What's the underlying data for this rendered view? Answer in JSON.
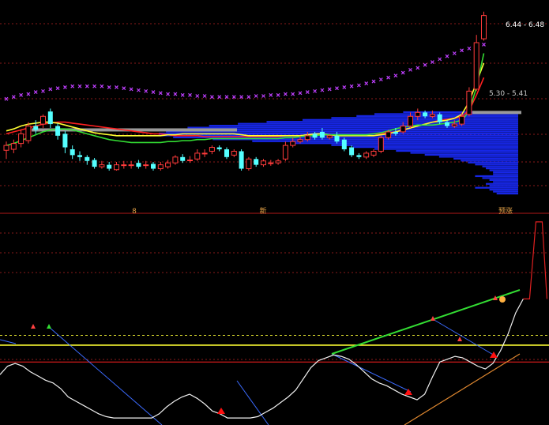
{
  "chart_data": [
    {
      "type": "candlestick",
      "title": "",
      "price_range_label": "6.44 - 6.48",
      "price_level_label": "5.30 - 5.41",
      "colors": {
        "up": "#ff3b3b",
        "down": "#54ffff",
        "ma_yellow": "#ffff33",
        "ma_red": "#ff2020",
        "ma_green": "#33dd33",
        "sar": "#c040ff",
        "volume_profile": "#1a2bff",
        "grid": "#8a1a1a"
      },
      "candles": [
        {
          "o": 5.05,
          "c": 5.1,
          "h": 5.14,
          "l": 4.96,
          "up": true
        },
        {
          "o": 5.06,
          "c": 5.12,
          "h": 5.16,
          "l": 5.02,
          "up": true
        },
        {
          "o": 5.12,
          "c": 5.22,
          "h": 5.26,
          "l": 5.08,
          "up": true
        },
        {
          "o": 5.15,
          "c": 5.3,
          "h": 5.34,
          "l": 5.12,
          "up": true
        },
        {
          "o": 5.3,
          "c": 5.26,
          "h": 5.36,
          "l": 5.22,
          "up": false
        },
        {
          "o": 5.32,
          "c": 5.4,
          "h": 5.42,
          "l": 5.28,
          "up": true
        },
        {
          "o": 5.45,
          "c": 5.32,
          "h": 5.48,
          "l": 5.28,
          "up": false
        },
        {
          "o": 5.3,
          "c": 5.2,
          "h": 5.33,
          "l": 5.16,
          "up": false
        },
        {
          "o": 5.22,
          "c": 5.08,
          "h": 5.25,
          "l": 5.02,
          "up": false
        },
        {
          "o": 5.06,
          "c": 5.0,
          "h": 5.1,
          "l": 4.96,
          "up": false
        },
        {
          "o": 5.0,
          "c": 4.98,
          "h": 5.04,
          "l": 4.94,
          "up": false
        },
        {
          "o": 4.98,
          "c": 4.94,
          "h": 5.0,
          "l": 4.9,
          "up": false
        },
        {
          "o": 4.95,
          "c": 4.88,
          "h": 4.97,
          "l": 4.86,
          "up": false
        },
        {
          "o": 4.88,
          "c": 4.9,
          "h": 4.94,
          "l": 4.86,
          "up": true
        },
        {
          "o": 4.9,
          "c": 4.86,
          "h": 4.93,
          "l": 4.84,
          "up": false
        },
        {
          "o": 4.85,
          "c": 4.9,
          "h": 4.93,
          "l": 4.84,
          "up": true
        },
        {
          "o": 4.9,
          "c": 4.9,
          "h": 4.94,
          "l": 4.86,
          "up": true
        },
        {
          "o": 4.9,
          "c": 4.9,
          "h": 4.94,
          "l": 4.86,
          "up": true
        },
        {
          "o": 4.92,
          "c": 4.88,
          "h": 4.95,
          "l": 4.86,
          "up": false
        },
        {
          "o": 4.9,
          "c": 4.9,
          "h": 4.94,
          "l": 4.86,
          "up": true
        },
        {
          "o": 4.91,
          "c": 4.86,
          "h": 4.93,
          "l": 4.84,
          "up": false
        },
        {
          "o": 4.86,
          "c": 4.9,
          "h": 4.93,
          "l": 4.84,
          "up": true
        },
        {
          "o": 4.88,
          "c": 4.92,
          "h": 4.95,
          "l": 4.86,
          "up": true
        },
        {
          "o": 4.92,
          "c": 4.98,
          "h": 5.0,
          "l": 4.9,
          "up": true
        },
        {
          "o": 4.98,
          "c": 4.94,
          "h": 5.01,
          "l": 4.92,
          "up": false
        },
        {
          "o": 4.95,
          "c": 4.95,
          "h": 4.99,
          "l": 4.92,
          "up": true
        },
        {
          "o": 4.96,
          "c": 5.02,
          "h": 5.06,
          "l": 4.94,
          "up": true
        },
        {
          "o": 5.02,
          "c": 5.02,
          "h": 5.06,
          "l": 4.98,
          "up": true
        },
        {
          "o": 5.04,
          "c": 5.08,
          "h": 5.1,
          "l": 5.01,
          "up": true
        },
        {
          "o": 5.08,
          "c": 5.06,
          "h": 5.1,
          "l": 5.04,
          "up": false
        },
        {
          "o": 5.06,
          "c": 4.98,
          "h": 5.08,
          "l": 4.96,
          "up": false
        },
        {
          "o": 5.0,
          "c": 5.04,
          "h": 5.06,
          "l": 4.98,
          "up": true
        },
        {
          "o": 5.04,
          "c": 4.86,
          "h": 5.06,
          "l": 4.84,
          "up": false
        },
        {
          "o": 4.86,
          "c": 4.96,
          "h": 4.98,
          "l": 4.84,
          "up": true
        },
        {
          "o": 4.96,
          "c": 4.9,
          "h": 4.98,
          "l": 4.88,
          "up": false
        },
        {
          "o": 4.9,
          "c": 4.94,
          "h": 4.96,
          "l": 4.88,
          "up": true
        },
        {
          "o": 4.92,
          "c": 4.92,
          "h": 4.95,
          "l": 4.89,
          "up": true
        },
        {
          "o": 4.92,
          "c": 4.94,
          "h": 4.96,
          "l": 4.9,
          "up": true
        },
        {
          "o": 4.96,
          "c": 5.1,
          "h": 5.14,
          "l": 4.94,
          "up": true
        },
        {
          "o": 5.1,
          "c": 5.14,
          "h": 5.18,
          "l": 5.08,
          "up": true
        },
        {
          "o": 5.14,
          "c": 5.16,
          "h": 5.2,
          "l": 5.12,
          "up": true
        },
        {
          "o": 5.16,
          "c": 5.2,
          "h": 5.24,
          "l": 5.14,
          "up": true
        },
        {
          "o": 5.22,
          "c": 5.18,
          "h": 5.24,
          "l": 5.16,
          "up": false
        },
        {
          "o": 5.24,
          "c": 5.18,
          "h": 5.28,
          "l": 5.16,
          "up": false
        },
        {
          "o": 5.18,
          "c": 5.2,
          "h": 5.22,
          "l": 5.16,
          "up": true
        },
        {
          "o": 5.2,
          "c": 5.14,
          "h": 5.24,
          "l": 5.12,
          "up": false
        },
        {
          "o": 5.16,
          "c": 5.06,
          "h": 5.18,
          "l": 5.04,
          "up": false
        },
        {
          "o": 5.08,
          "c": 5.0,
          "h": 5.1,
          "l": 4.98,
          "up": false
        },
        {
          "o": 5.0,
          "c": 4.98,
          "h": 5.02,
          "l": 4.96,
          "up": false
        },
        {
          "o": 4.98,
          "c": 5.02,
          "h": 5.04,
          "l": 4.96,
          "up": true
        },
        {
          "o": 5.0,
          "c": 5.04,
          "h": 5.06,
          "l": 4.98,
          "up": true
        },
        {
          "o": 5.04,
          "c": 5.18,
          "h": 5.2,
          "l": 5.02,
          "up": true
        },
        {
          "o": 5.18,
          "c": 5.24,
          "h": 5.26,
          "l": 5.16,
          "up": true
        },
        {
          "o": 5.24,
          "c": 5.22,
          "h": 5.28,
          "l": 5.2,
          "up": false
        },
        {
          "o": 5.24,
          "c": 5.3,
          "h": 5.34,
          "l": 5.22,
          "up": true
        },
        {
          "o": 5.3,
          "c": 5.4,
          "h": 5.44,
          "l": 5.28,
          "up": true
        },
        {
          "o": 5.4,
          "c": 5.44,
          "h": 5.48,
          "l": 5.36,
          "up": true
        },
        {
          "o": 5.44,
          "c": 5.4,
          "h": 5.46,
          "l": 5.38,
          "up": false
        },
        {
          "o": 5.4,
          "c": 5.42,
          "h": 5.46,
          "l": 5.38,
          "up": true
        },
        {
          "o": 5.42,
          "c": 5.34,
          "h": 5.44,
          "l": 5.32,
          "up": false
        },
        {
          "o": 5.34,
          "c": 5.3,
          "h": 5.36,
          "l": 5.28,
          "up": false
        },
        {
          "o": 5.3,
          "c": 5.32,
          "h": 5.36,
          "l": 5.28,
          "up": true
        },
        {
          "o": 5.32,
          "c": 5.4,
          "h": 5.44,
          "l": 5.3,
          "up": true
        },
        {
          "o": 5.42,
          "c": 5.66,
          "h": 5.7,
          "l": 5.4,
          "up": true
        },
        {
          "o": 5.68,
          "c": 6.16,
          "h": 6.24,
          "l": 5.66,
          "up": true
        },
        {
          "o": 6.2,
          "c": 6.44,
          "h": 6.48,
          "l": 6.18,
          "up": true
        }
      ],
      "sar": [
        5.58,
        5.6,
        5.62,
        5.63,
        5.65,
        5.66,
        5.68,
        5.69,
        5.7,
        5.71,
        5.71,
        5.71,
        5.71,
        5.71,
        5.7,
        5.7,
        5.69,
        5.68,
        5.67,
        5.66,
        5.65,
        5.64,
        5.63,
        5.63,
        5.62,
        5.62,
        5.61,
        5.61,
        5.6,
        5.6,
        5.6,
        5.6,
        5.6,
        5.6,
        5.61,
        5.61,
        5.62,
        5.62,
        5.63,
        5.63,
        5.64,
        5.65,
        5.66,
        5.67,
        5.68,
        5.69,
        5.7,
        5.71,
        5.72,
        5.74,
        5.76,
        5.78,
        5.8,
        5.82,
        5.85,
        5.88,
        5.9,
        5.93,
        5.96,
        5.99,
        6.02,
        6.05,
        6.08,
        6.1,
        6.12,
        6.14
      ],
      "ma_yellow": [
        5.25,
        5.27,
        5.3,
        5.32,
        5.33,
        5.34,
        5.34,
        5.33,
        5.31,
        5.29,
        5.27,
        5.25,
        5.23,
        5.22,
        5.21,
        5.2,
        5.2,
        5.2,
        5.2,
        5.2,
        5.2,
        5.2,
        5.21,
        5.21,
        5.22,
        5.22,
        5.22,
        5.22,
        5.22,
        5.22,
        5.22,
        5.22,
        5.21,
        5.2,
        5.2,
        5.2,
        5.2,
        5.2,
        5.2,
        5.2,
        5.2,
        5.21,
        5.22,
        5.22,
        5.21,
        5.2,
        5.2,
        5.2,
        5.2,
        5.2,
        5.2,
        5.21,
        5.22,
        5.24,
        5.26,
        5.28,
        5.3,
        5.32,
        5.34,
        5.35,
        5.36,
        5.38,
        5.42,
        5.55,
        5.75,
        5.95
      ],
      "ma_red": [
        5.22,
        5.24,
        5.26,
        5.28,
        5.3,
        5.32,
        5.33,
        5.34,
        5.34,
        5.33,
        5.32,
        5.31,
        5.3,
        5.29,
        5.28,
        5.27,
        5.26,
        5.25,
        5.24,
        5.23,
        5.22,
        5.22,
        5.21,
        5.2,
        5.2,
        5.2,
        5.2,
        5.19,
        5.19,
        5.19,
        5.19,
        5.19,
        5.19,
        5.19,
        5.19,
        5.19,
        5.19,
        5.19,
        5.2,
        5.2,
        5.2,
        5.21,
        5.21,
        5.21,
        5.21,
        5.21,
        5.21,
        5.21,
        5.21,
        5.21,
        5.22,
        5.22,
        5.23,
        5.24,
        5.26,
        5.28,
        5.3,
        5.32,
        5.34,
        5.36,
        5.37,
        5.38,
        5.4,
        5.46,
        5.62,
        5.8
      ],
      "ma_green": [
        5.1,
        5.12,
        5.15,
        5.18,
        5.21,
        5.24,
        5.26,
        5.27,
        5.27,
        5.26,
        5.24,
        5.22,
        5.2,
        5.18,
        5.16,
        5.15,
        5.14,
        5.13,
        5.13,
        5.13,
        5.13,
        5.13,
        5.14,
        5.14,
        5.15,
        5.15,
        5.16,
        5.16,
        5.17,
        5.17,
        5.17,
        5.17,
        5.17,
        5.17,
        5.17,
        5.17,
        5.17,
        5.17,
        5.18,
        5.18,
        5.19,
        5.2,
        5.2,
        5.21,
        5.21,
        5.21,
        5.21,
        5.21,
        5.21,
        5.21,
        5.22,
        5.23,
        5.25,
        5.27,
        5.29,
        5.3,
        5.31,
        5.31,
        5.31,
        5.32,
        5.33,
        5.34,
        5.36,
        5.45,
        5.7,
        6.05
      ],
      "volume_profile": [
        {
          "price": 5.44,
          "w": 0.32
        },
        {
          "price": 5.42,
          "w": 0.4
        },
        {
          "price": 5.4,
          "w": 0.45
        },
        {
          "price": 5.38,
          "w": 0.52
        },
        {
          "price": 5.36,
          "w": 0.6
        },
        {
          "price": 5.34,
          "w": 0.7
        },
        {
          "price": 5.32,
          "w": 0.78
        },
        {
          "price": 5.3,
          "w": 0.86
        },
        {
          "price": 5.28,
          "w": 0.92
        },
        {
          "price": 5.26,
          "w": 0.95
        },
        {
          "price": 5.24,
          "w": 0.98
        },
        {
          "price": 5.22,
          "w": 1.0
        },
        {
          "price": 5.2,
          "w": 1.0
        },
        {
          "price": 5.18,
          "w": 0.96
        },
        {
          "price": 5.16,
          "w": 0.85
        },
        {
          "price": 5.14,
          "w": 0.74
        },
        {
          "price": 5.12,
          "w": 0.62
        },
        {
          "price": 5.1,
          "w": 0.52
        },
        {
          "price": 5.08,
          "w": 0.46
        },
        {
          "price": 5.06,
          "w": 0.4
        },
        {
          "price": 5.04,
          "w": 0.34
        },
        {
          "price": 5.02,
          "w": 0.3
        },
        {
          "price": 5.0,
          "w": 0.26
        },
        {
          "price": 4.98,
          "w": 0.22
        },
        {
          "price": 4.96,
          "w": 0.18
        },
        {
          "price": 4.94,
          "w": 0.16
        },
        {
          "price": 4.92,
          "w": 0.14
        },
        {
          "price": 4.9,
          "w": 0.12
        },
        {
          "price": 4.88,
          "w": 0.1
        },
        {
          "price": 4.86,
          "w": 0.09
        },
        {
          "price": 4.84,
          "w": 0.08
        },
        {
          "price": 4.82,
          "w": 0.07
        },
        {
          "price": 4.8,
          "w": 0.07
        },
        {
          "price": 4.78,
          "w": 0.12
        },
        {
          "price": 4.76,
          "w": 0.1
        },
        {
          "price": 4.74,
          "w": 0.08
        },
        {
          "price": 4.72,
          "w": 0.07
        },
        {
          "price": 4.7,
          "w": 0.09
        },
        {
          "price": 4.68,
          "w": 0.08
        },
        {
          "price": 4.66,
          "w": 0.12
        },
        {
          "price": 4.64,
          "w": 0.08
        },
        {
          "price": 4.62,
          "w": 0.07
        },
        {
          "price": 4.6,
          "w": 0.06
        }
      ],
      "ylim": [
        4.4,
        6.6
      ]
    },
    {
      "type": "line",
      "title": "",
      "divider_labels": [
        {
          "text": "8"
        },
        {
          "text": "新"
        },
        {
          "text": "预涨"
        }
      ],
      "oscillator": [
        62,
        74,
        78,
        74,
        66,
        60,
        54,
        50,
        42,
        30,
        24,
        18,
        12,
        6,
        2,
        0,
        0,
        0,
        0,
        0,
        0,
        6,
        16,
        24,
        30,
        34,
        28,
        20,
        10,
        6,
        0,
        0,
        0,
        0,
        2,
        8,
        14,
        22,
        30,
        40,
        56,
        72,
        82,
        86,
        90,
        88,
        84,
        76,
        66,
        56,
        50,
        46,
        40,
        34,
        30,
        26,
        34,
        58,
        80,
        84,
        88,
        86,
        80,
        74,
        70,
        78,
        96,
        120,
        150,
        170
      ],
      "oscillator_peak": [
        170,
        240,
        280
      ],
      "reference_lines": {
        "yellow_solid": 104,
        "yellow_dotted": 118,
        "red": 80
      },
      "trend_lines": [
        {
          "color": "#33dd33",
          "from": [
            0,
            80
          ],
          "to": [
            0,
            120
          ]
        },
        {
          "color": "#3b6bff",
          "from": [
            0,
            0
          ],
          "to": [
            0,
            0
          ]
        }
      ],
      "ylim": [
        -10,
        290
      ]
    }
  ]
}
